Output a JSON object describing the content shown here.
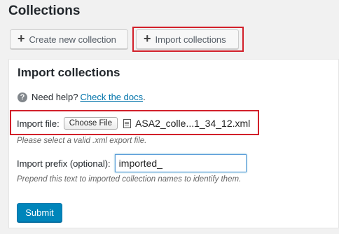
{
  "page": {
    "title": "Collections"
  },
  "toolbar": {
    "create_label": "Create new collection",
    "import_label": "Import collections",
    "plus_glyph": "+"
  },
  "import_panel": {
    "title": "Import collections",
    "help_text": "Need help?",
    "help_link": "Check the docs",
    "help_suffix": ".",
    "file_label": "Import file:",
    "choose_file_label": "Choose File",
    "file_name": "ASA2_colle...1_34_12.xml",
    "file_desc": "Please select a valid .xml export file.",
    "prefix_label": "Import prefix (optional):",
    "prefix_value": "imported_",
    "prefix_desc": "Prepend this text to imported collection names to identify them.",
    "submit_label": "Submit"
  },
  "icons": {
    "help": "question-circle-icon",
    "plus": "plus-icon",
    "file": "file-icon"
  },
  "colors": {
    "highlight": "#d2202a",
    "link": "#0073aa",
    "primary": "#0085ba"
  }
}
